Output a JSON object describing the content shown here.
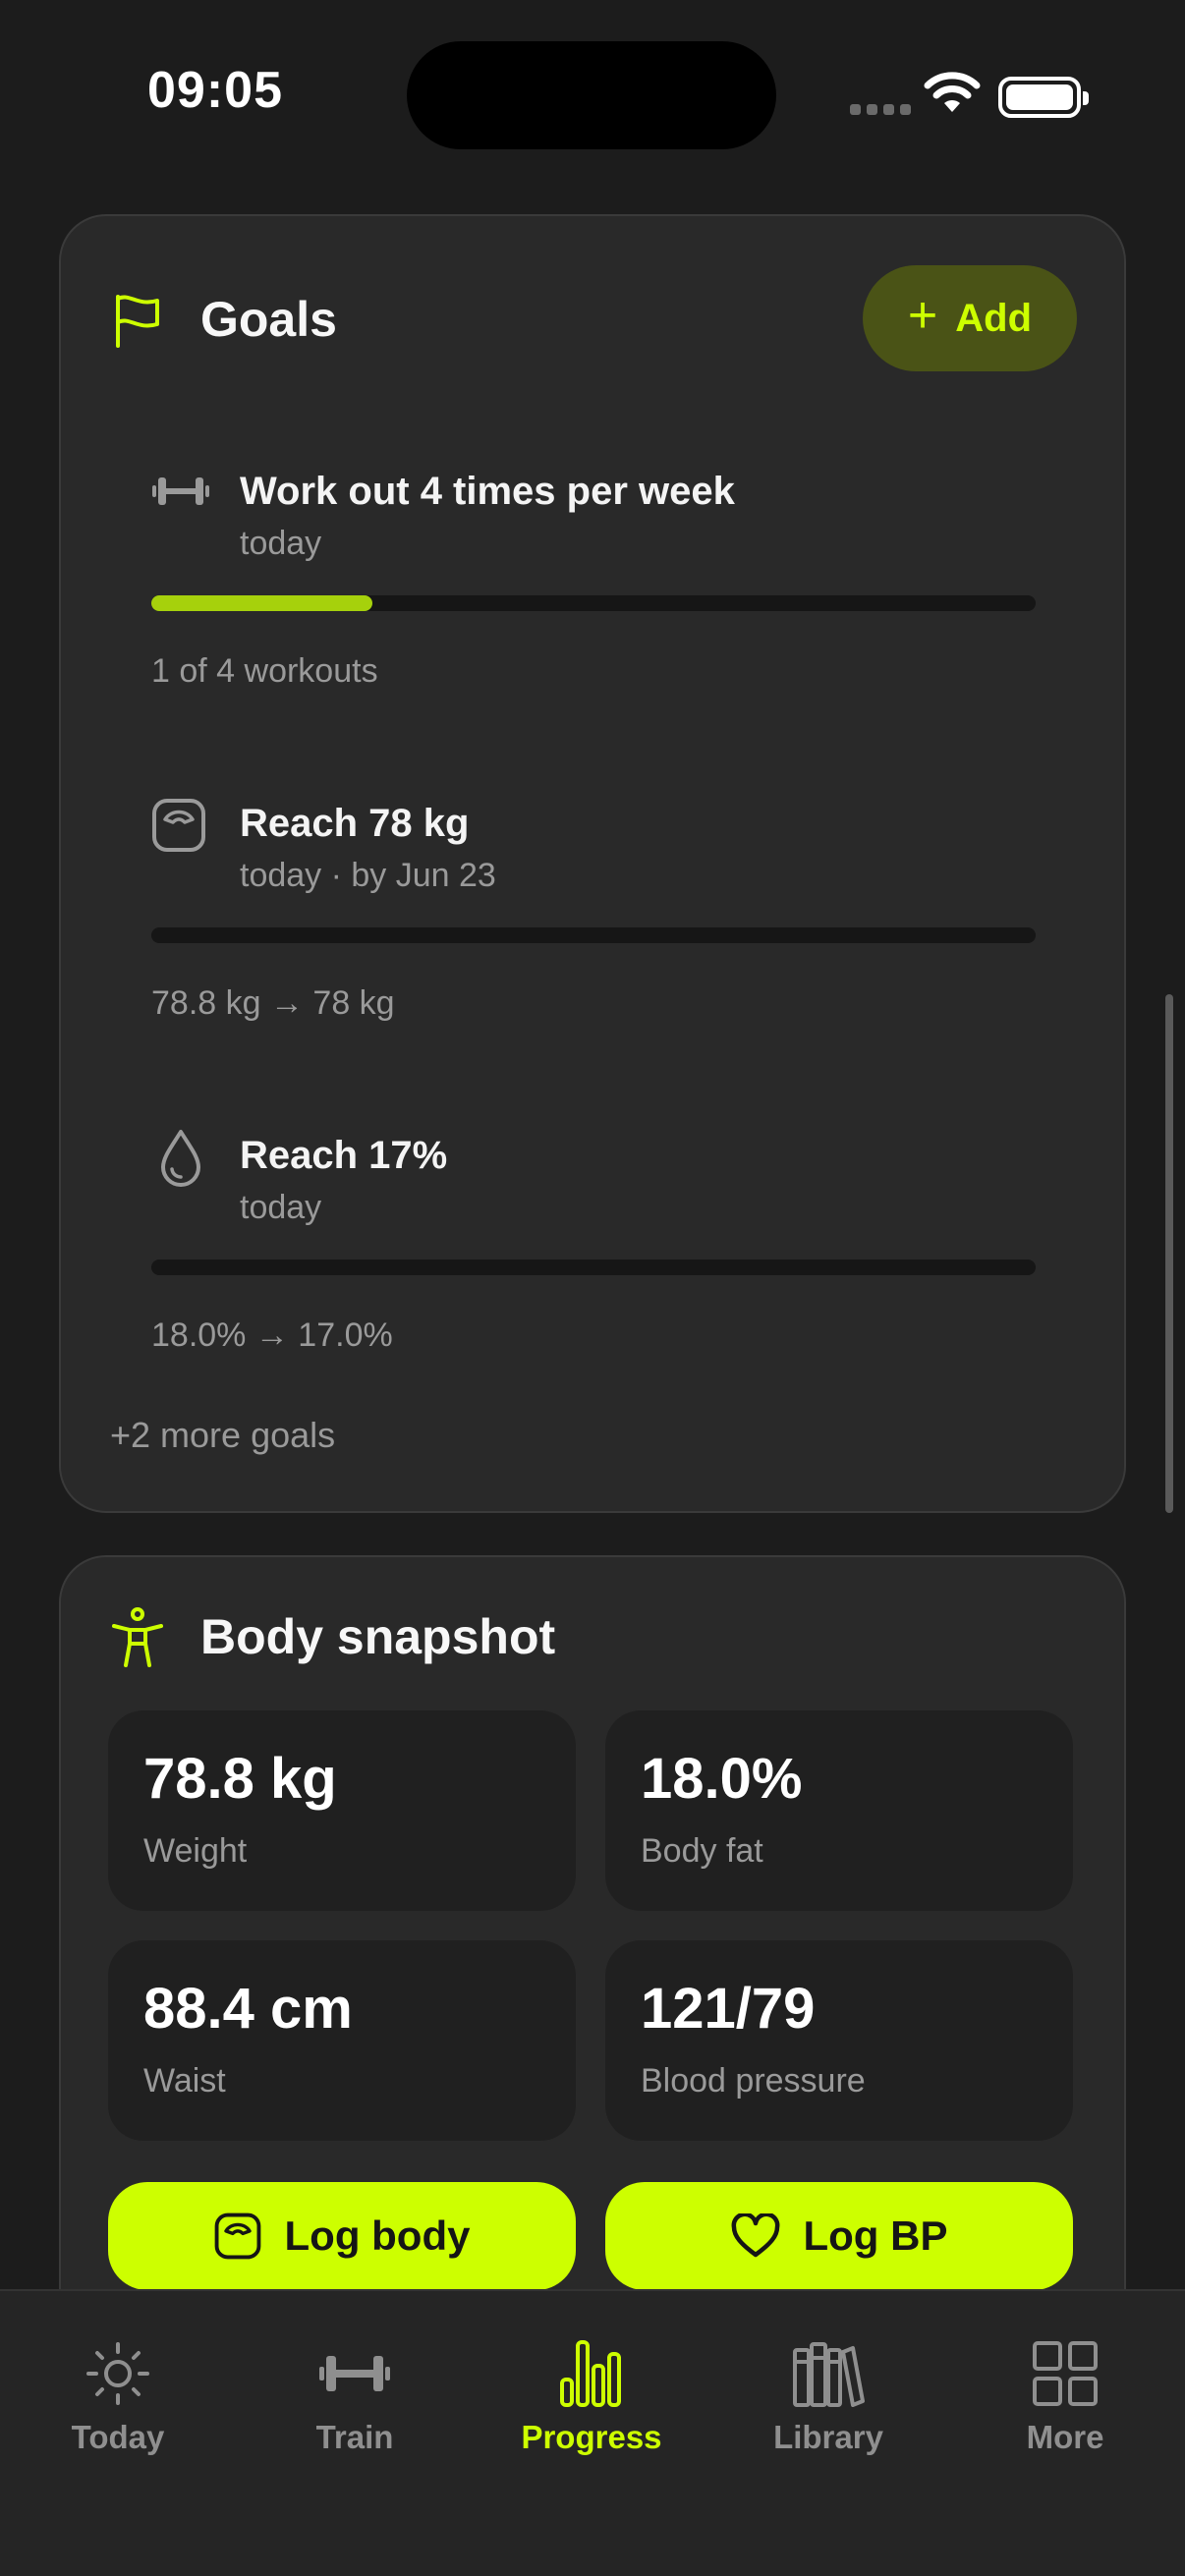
{
  "status_bar": {
    "time": "09:05"
  },
  "colors": {
    "accent": "#cdff00",
    "progress": "#a6d10c",
    "card": "#292929",
    "background": "#1c1c1c"
  },
  "goals": {
    "title": "Goals",
    "icon": "flag-icon",
    "add_label": "Add",
    "items": [
      {
        "icon": "dumbbell-icon",
        "title": "Work out 4 times per week",
        "subtitle": "today",
        "progress": 0.25,
        "detail": "1 of 4 workouts"
      },
      {
        "icon": "scale-icon",
        "title": "Reach 78 kg",
        "subtitle": "today · by Jun 23",
        "progress": 0,
        "detail": "78.8 kg → 78 kg"
      },
      {
        "icon": "drop-icon",
        "title": "Reach 17%",
        "subtitle": "today",
        "progress": 0,
        "detail": "18.0% → 17.0%"
      }
    ],
    "more_label": "+2 more goals"
  },
  "body_snapshot": {
    "title": "Body snapshot",
    "icon": "person-icon",
    "metrics": [
      {
        "value": "78.8 kg",
        "label": "Weight"
      },
      {
        "value": "18.0%",
        "label": "Body fat"
      },
      {
        "value": "88.4 cm",
        "label": "Waist"
      },
      {
        "value": "121/79",
        "label": "Blood pressure"
      }
    ],
    "actions": [
      {
        "label": "Log body",
        "icon": "scale-icon"
      },
      {
        "label": "Log BP",
        "icon": "heart-icon"
      }
    ]
  },
  "tab_bar": {
    "active": "Progress",
    "tabs": [
      {
        "label": "Today",
        "icon": "sun-icon"
      },
      {
        "label": "Train",
        "icon": "dumbbell-icon"
      },
      {
        "label": "Progress",
        "icon": "bar-chart-icon"
      },
      {
        "label": "Library",
        "icon": "books-icon"
      },
      {
        "label": "More",
        "icon": "grid-icon"
      }
    ]
  }
}
